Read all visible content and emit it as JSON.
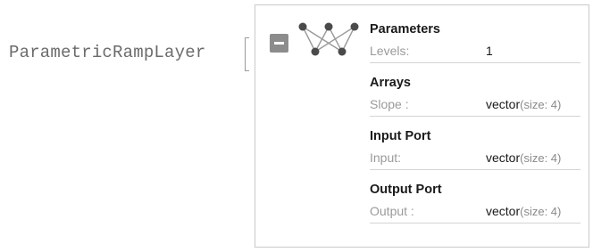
{
  "expression": {
    "head": "ParametricRampLayer"
  },
  "panel": {
    "toggle_icon": "minus-icon",
    "graph_icon": "neural-net-graph-icon",
    "colors": {
      "node": "#4a4a4a",
      "edge": "#9a9a9a",
      "toggle": "#8c8c8c",
      "border": "#c9c9c9",
      "key_text": "#9a9a9a"
    },
    "sections": [
      {
        "title": "Parameters",
        "key": "Levels:",
        "value": "1",
        "value_hint": ""
      },
      {
        "title": "Arrays",
        "key": "Slope :",
        "value": "vector",
        "value_hint": "(size: 4)"
      },
      {
        "title": "Input Port",
        "key": "Input:",
        "value": "vector",
        "value_hint": "(size: 4)"
      },
      {
        "title": "Output Port",
        "key": "Output :",
        "value": "vector",
        "value_hint": "(size: 4)"
      }
    ]
  }
}
